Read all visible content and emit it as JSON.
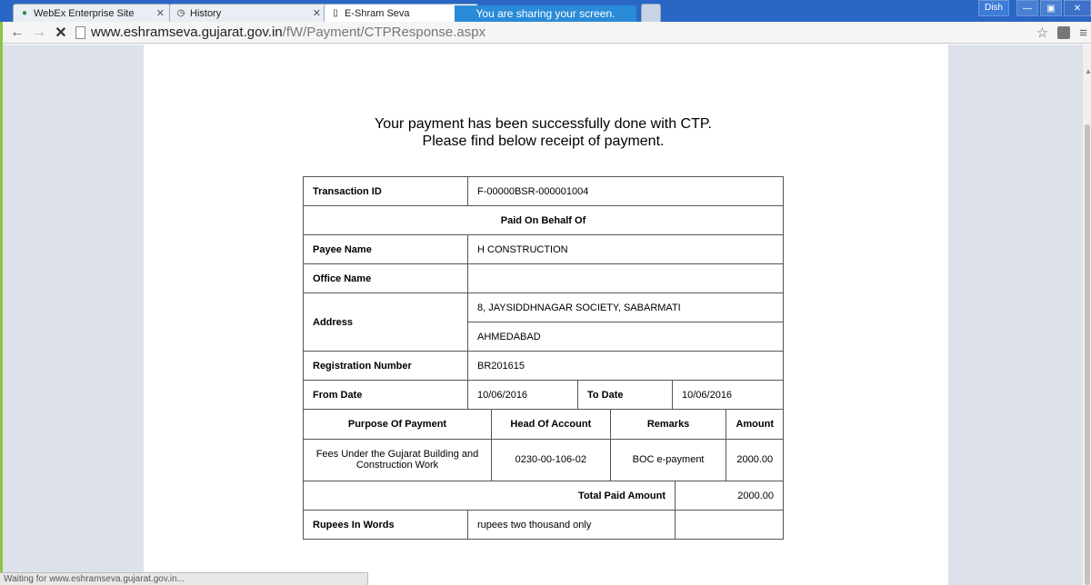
{
  "browser": {
    "tabs": [
      {
        "title": "WebEx Enterprise Site",
        "icon": "webex-icon"
      },
      {
        "title": "History",
        "icon": "history-icon"
      },
      {
        "title": "E-Shram Seva",
        "icon": "page-icon"
      }
    ],
    "sharing_banner": "You are sharing your screen.",
    "profile": "Dish",
    "url_host": "www.eshramseva.gujarat.gov.in",
    "url_path": "/fW/Payment/CTPResponse.aspx",
    "status": "Waiting for www.eshramseva.gujarat.gov.in..."
  },
  "page": {
    "message_line1": "Your payment has been successfully done with CTP.",
    "message_line2": "Please find below receipt of payment."
  },
  "receipt": {
    "transaction_id_label": "Transaction ID",
    "transaction_id": "F-00000BSR-000001004",
    "paid_on_behalf_of": "Paid On Behalf Of",
    "payee_name_label": "Payee Name",
    "payee_name": "H CONSTRUCTION",
    "office_name_label": "Office Name",
    "office_name": "",
    "address_label": "Address",
    "address_line1": "8, JAYSIDDHNAGAR SOCIETY, SABARMATI",
    "address_line2": "AHMEDABAD",
    "registration_number_label": "Registration Number",
    "registration_number": "BR201615",
    "from_date_label": "From Date",
    "from_date": "10/06/2016",
    "to_date_label": "To Date",
    "to_date": "10/06/2016",
    "columns": {
      "purpose": "Purpose Of Payment",
      "head": "Head Of Account",
      "remarks": "Remarks",
      "amount": "Amount"
    },
    "row": {
      "purpose": "Fees Under the Gujarat Building and Construction Work",
      "head": "0230-00-106-02",
      "remarks": "BOC e-payment",
      "amount": "2000.00"
    },
    "total_label": "Total Paid Amount",
    "total": "2000.00",
    "rupees_in_words_label": "Rupees In Words",
    "rupees_in_words": "rupees two thousand only"
  }
}
